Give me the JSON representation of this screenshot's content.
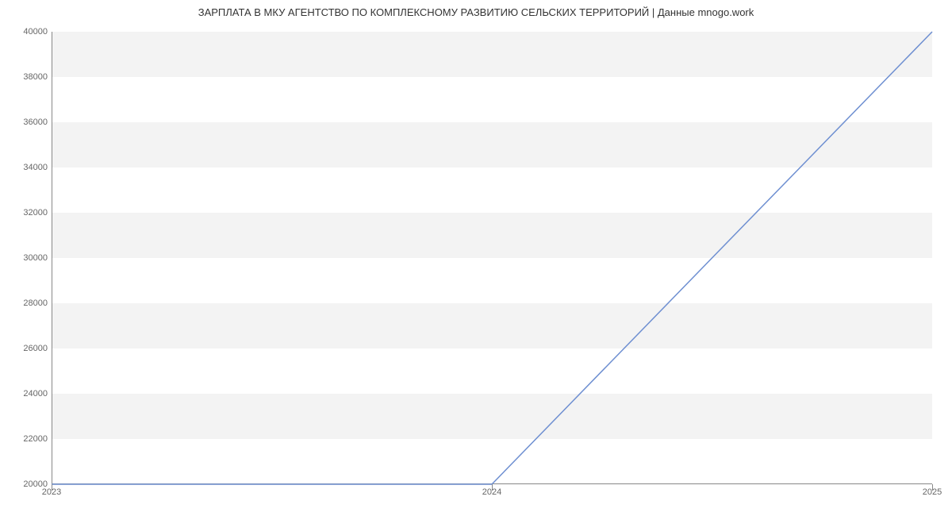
{
  "chart_data": {
    "type": "line",
    "title": "ЗАРПЛАТА В МКУ АГЕНТСТВО ПО КОМПЛЕКСНОМУ РАЗВИТИЮ СЕЛЬСКИХ ТЕРРИТОРИЙ | Данные mnogo.work",
    "xlabel": "",
    "ylabel": "",
    "x": [
      2023,
      2024,
      2025
    ],
    "values": [
      20000,
      20000,
      40000
    ],
    "x_ticks": [
      2023,
      2024,
      2025
    ],
    "y_ticks": [
      20000,
      22000,
      24000,
      26000,
      28000,
      30000,
      32000,
      34000,
      36000,
      38000,
      40000
    ],
    "xlim": [
      2023,
      2025
    ],
    "ylim": [
      20000,
      40000
    ],
    "line_color": "#6e8fd1"
  }
}
